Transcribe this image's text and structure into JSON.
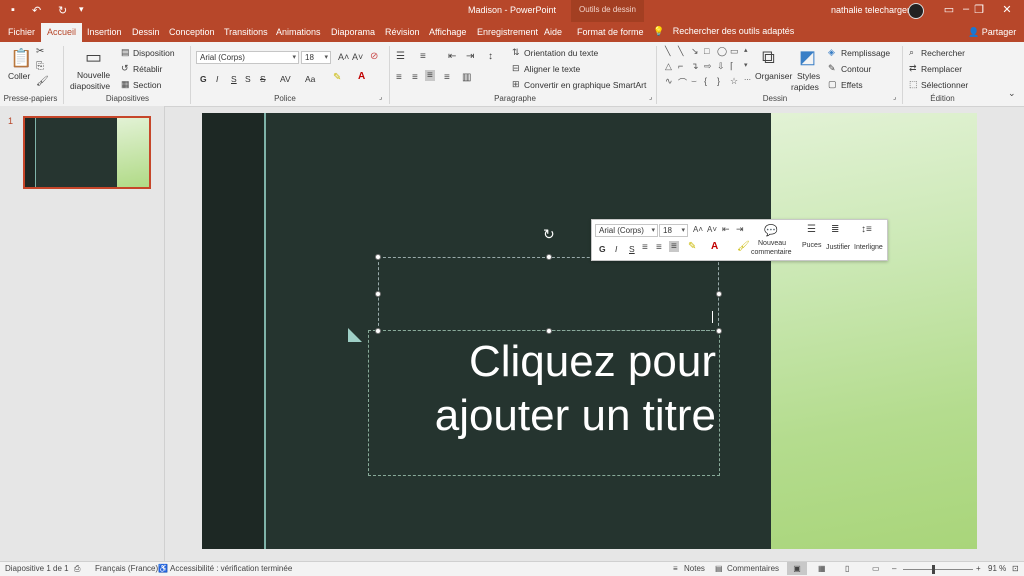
{
  "window": {
    "title": "Madison  -  PowerPoint",
    "context_group": "Outils de dessin",
    "user_name": "nathalie telecharger"
  },
  "tabs": [
    "Fichier",
    "Accueil",
    "Insertion",
    "Dessin",
    "Conception",
    "Transitions",
    "Animations",
    "Diaporama",
    "Révision",
    "Affichage",
    "Enregistrement",
    "Aide",
    "Format de forme"
  ],
  "tell_me": "Rechercher des outils adaptés",
  "share_label": "Partager",
  "ribbon": {
    "clipboard": {
      "paste": "Coller",
      "group": "Presse-papiers"
    },
    "slides": {
      "new_slide_1": "Nouvelle",
      "new_slide_2": "diapositive",
      "layout": "Disposition",
      "reset": "Rétablir",
      "section": "Section",
      "group": "Diapositives"
    },
    "font": {
      "name": "Arial (Corps)",
      "size": "18",
      "bold": "G",
      "italic": "I",
      "underline": "S",
      "strike": "S",
      "spacing": "AV",
      "case": "Aa",
      "group": "Police"
    },
    "paragraph": {
      "text_direction": "Orientation du texte",
      "align_text": "Aligner le texte",
      "smartart": "Convertir en graphique SmartArt",
      "group": "Paragraphe"
    },
    "drawing": {
      "arrange": "Organiser",
      "styles_1": "Styles",
      "styles_2": "rapides",
      "fill": "Remplissage",
      "outline": "Contour",
      "effects": "Effets",
      "group": "Dessin"
    },
    "editing": {
      "find": "Rechercher",
      "replace": "Remplacer",
      "select": "Sélectionner",
      "group": "Édition"
    }
  },
  "thumbnail": {
    "number": "1"
  },
  "slide": {
    "title_line1": "Cliquez pour",
    "title_line2": "ajouter un titre"
  },
  "mini_toolbar": {
    "font": "Arial (Corps)",
    "size": "18",
    "bold": "G",
    "italic": "I",
    "underline": "S",
    "new_comment_1": "Nouveau",
    "new_comment_2": "commentaire",
    "bullets": "Puces",
    "justify": "Justifier",
    "line_spacing": "Interligne"
  },
  "status": {
    "slide_info": "Diapositive 1 de 1",
    "language": "Français (France)",
    "accessibility": "Accessibilité : vérification terminée",
    "notes": "Notes",
    "comments": "Commentaires",
    "zoom": "91 %"
  },
  "colors": {
    "accent": "#b7472a",
    "slide_bg": "#25342f",
    "slide_green": "#b4dc8e"
  }
}
